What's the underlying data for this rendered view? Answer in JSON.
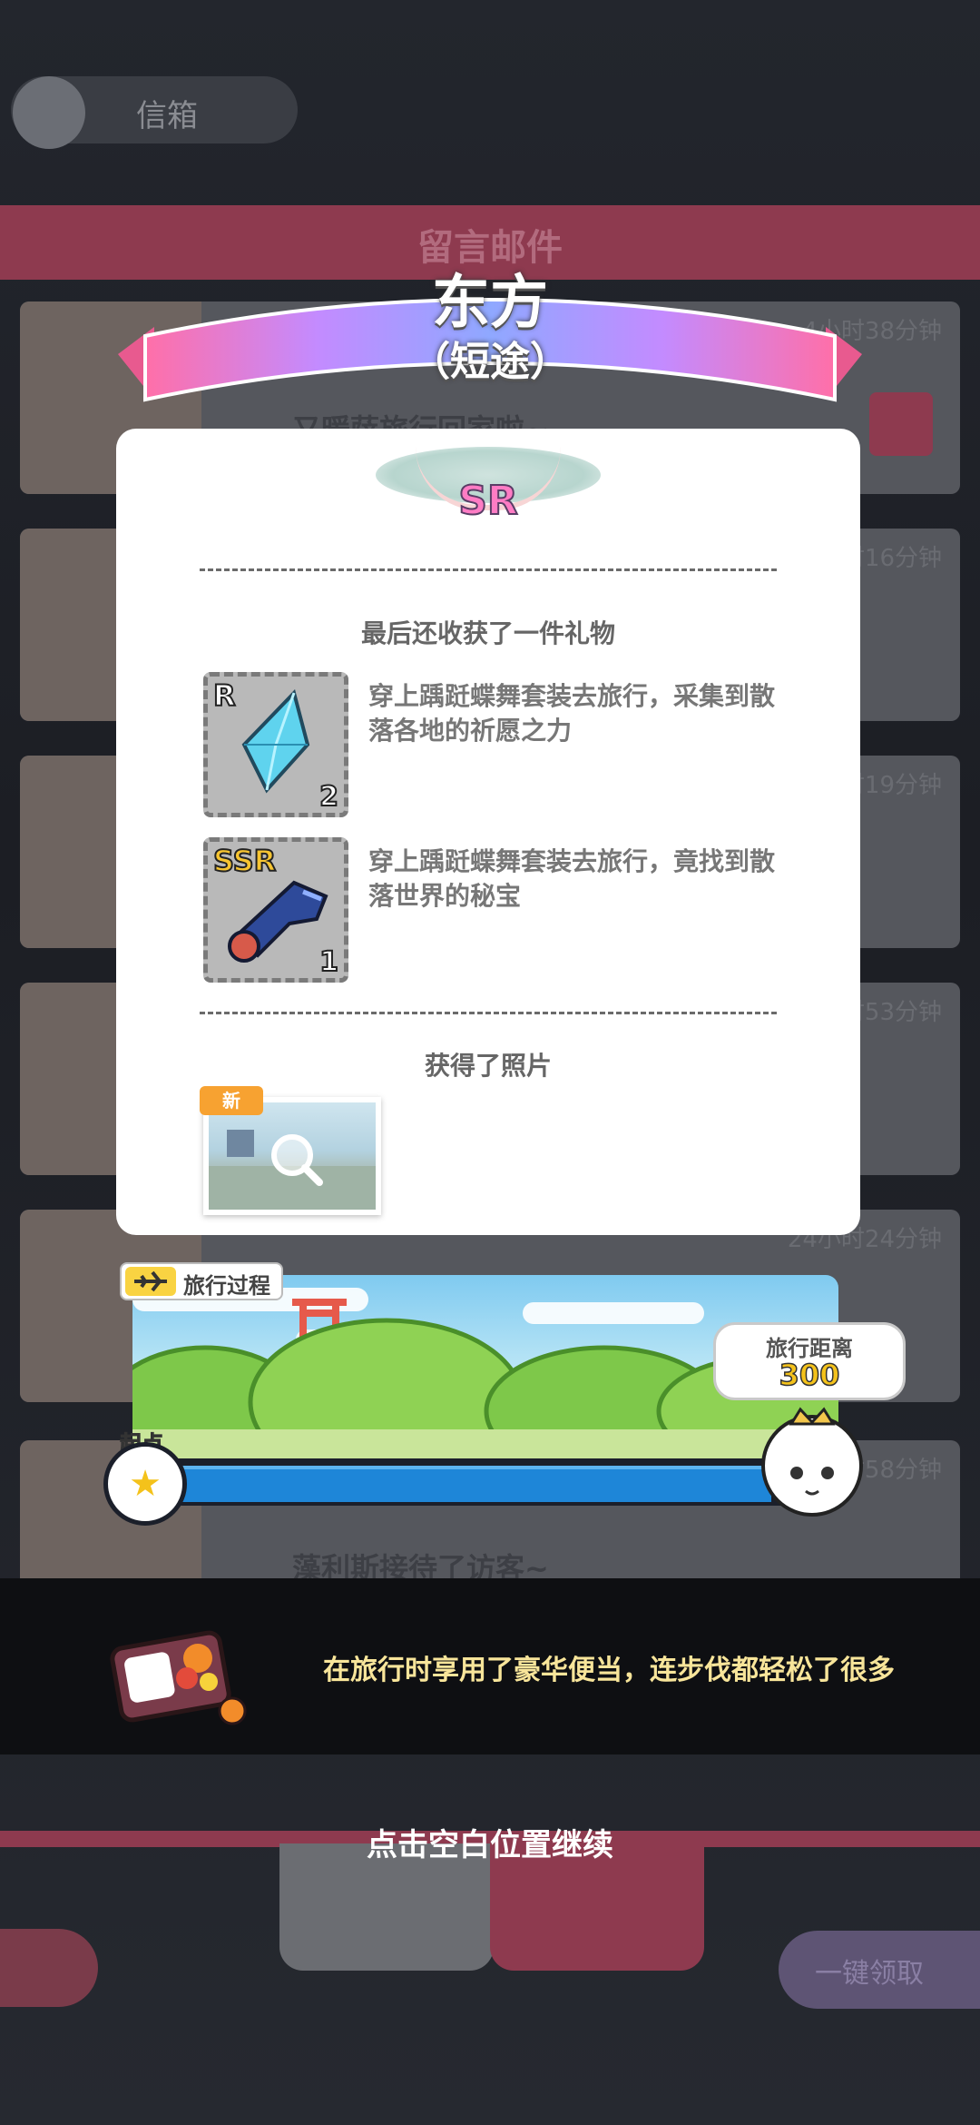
{
  "background": {
    "top_label": "信箱",
    "banner_label": "留言邮件",
    "card_stamps": [
      "4小时38分钟",
      "3小时16分钟",
      "2小时19分钟",
      "1小时53分钟",
      "24小时24分钟",
      "3小时58分钟"
    ],
    "card_texts": [
      "又暖萨旅行回家啦~",
      "",
      "",
      "",
      "",
      "藻利斯接待了访客~"
    ],
    "one_click_label": "一键领取"
  },
  "ribbon": {
    "title": "东方",
    "subtitle": "（短途）"
  },
  "result": {
    "rarity": "SR",
    "gift_section_title": "最后还收获了一件礼物",
    "items": [
      {
        "rarity": "R",
        "count": "2",
        "icon": "blue-crystal-icon",
        "description": "穿上踽跹蝶舞套装去旅行，采集到散落各地的祈愿之力"
      },
      {
        "rarity": "SSR",
        "count": "1",
        "icon": "toy-blaster-icon",
        "description": "穿上踽跹蝶舞套装去旅行，竟找到散落世界的秘宝"
      }
    ],
    "photo_section_title": "获得了照片",
    "photo_badge": "新"
  },
  "travel": {
    "tag_label": "旅行过程",
    "start_label": "起点",
    "distance_label": "旅行距离",
    "distance_value": "300"
  },
  "event": {
    "text": "在旅行时享用了豪华便当，连步伐都轻松了很多"
  },
  "continue_hint": "点击空白位置继续",
  "colors": {
    "card": "#ffffff",
    "sr_pink": "#ff7cc4",
    "distance_yellow": "#f4c21b",
    "event_text": "#f8e59a",
    "progress_blue": "#1e86d8"
  }
}
